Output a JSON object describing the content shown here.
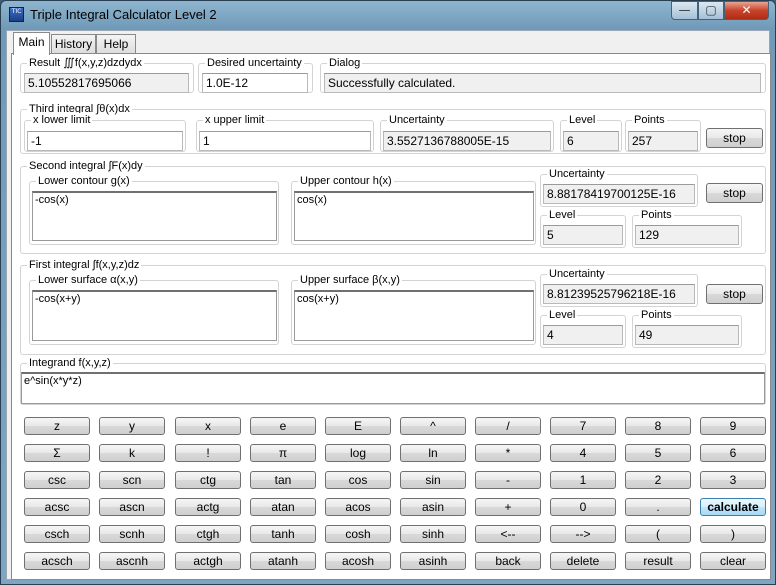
{
  "window": {
    "title": "Triple Integral Calculator Level 2",
    "icon_text": "TIC",
    "min_glyph": "—",
    "max_glyph": "▢",
    "close_glyph": "✕"
  },
  "tabs": [
    {
      "label": "Main"
    },
    {
      "label": "History"
    },
    {
      "label": "Help"
    }
  ],
  "result": {
    "label": "Result ∭f(x,y,z)dzdydx",
    "value": "5.10552817695066"
  },
  "desired": {
    "label": "Desired uncertainty",
    "value": "1.0E-12"
  },
  "dialog": {
    "label": "Dialog",
    "value": "Successfully calculated."
  },
  "third": {
    "label": "Third integral ∫θ(x)dx",
    "lower_label": "x lower limit",
    "lower_value": "-1",
    "upper_label": "x upper limit",
    "upper_value": "1",
    "unc_label": "Uncertainty",
    "unc_value": "3.5527136788005E-15",
    "level_label": "Level",
    "level_value": "6",
    "points_label": "Points",
    "points_value": "257",
    "stop_label": "stop"
  },
  "second": {
    "label": "Second integral ∫F(x)dy",
    "lower_label": "Lower contour g(x)",
    "lower_value": "-cos(x)",
    "upper_label": "Upper contour h(x)",
    "upper_value": "cos(x)",
    "unc_label": "Uncertainty",
    "unc_value": "8.88178419700125E-16",
    "level_label": "Level",
    "level_value": "5",
    "points_label": "Points",
    "points_value": "129",
    "stop_label": "stop"
  },
  "first": {
    "label": "First integral ∫f(x,y,z)dz",
    "lower_label": "Lower surface α(x,y)",
    "lower_value": "-cos(x+y)",
    "upper_label": "Upper surface β(x,y)",
    "upper_value": "cos(x+y)",
    "unc_label": "Uncertainty",
    "unc_value": "8.81239525796218E-16",
    "level_label": "Level",
    "level_value": "4",
    "points_label": "Points",
    "points_value": "49",
    "stop_label": "stop"
  },
  "integrand": {
    "label": "Integrand f(x,y,z)",
    "value": "e^sin(x*y*z)"
  },
  "keypad": [
    [
      "z",
      "y",
      "x",
      "e",
      "E",
      "^",
      "/",
      "7",
      "8",
      "9"
    ],
    [
      "Σ",
      "k",
      "!",
      "π",
      "log",
      "ln",
      "*",
      "4",
      "5",
      "6"
    ],
    [
      "csc",
      "scn",
      "ctg",
      "tan",
      "cos",
      "sin",
      "-",
      "1",
      "2",
      "3"
    ],
    [
      "acsc",
      "ascn",
      "actg",
      "atan",
      "acos",
      "asin",
      "+",
      "0",
      ".",
      "calculate"
    ],
    [
      "csch",
      "scnh",
      "ctgh",
      "tanh",
      "cosh",
      "sinh",
      "<--",
      "-->",
      "(",
      ")"
    ],
    [
      "acsch",
      "ascnh",
      "actgh",
      "atanh",
      "acosh",
      "asinh",
      "back",
      "delete",
      "result",
      "clear"
    ]
  ]
}
